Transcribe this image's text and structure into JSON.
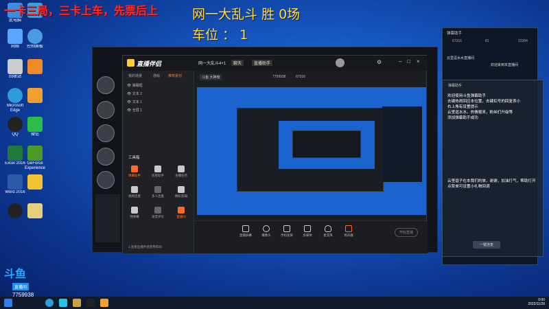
{
  "overlay": {
    "red_banner": "一卡三局，三卡上车，先票后上",
    "stats_line": "网一大乱斗 胜 0场",
    "seat_line": "车位 ： 1"
  },
  "desktop_icons": [
    {
      "label": "此电脑",
      "color": "#3d8de0"
    },
    {
      "label": "",
      "color": "#2ea4e8"
    },
    {
      "label": "网络",
      "color": "#5aa5ff"
    },
    {
      "label": "控制面板",
      "color": "#4a9be0"
    },
    {
      "label": "回收站",
      "color": "#cccccc"
    },
    {
      "label": "",
      "color": "#f08a24"
    },
    {
      "label": "Microsoft Edge",
      "color": "#2e9bdb"
    },
    {
      "label": "",
      "color": "#f0a030"
    },
    {
      "label": "QQ",
      "color": "#222222"
    },
    {
      "label": "微信",
      "color": "#2bbd4a"
    },
    {
      "label": "Excel 2016",
      "color": "#1e7a3e"
    },
    {
      "label": "GeForce Experience",
      "color": "#4b9b26"
    },
    {
      "label": "Word 2016",
      "color": "#2a5aa8"
    },
    {
      "label": "",
      "color": "#f2c230"
    },
    {
      "label": "",
      "color": "#222222"
    },
    {
      "label": "",
      "color": "#e8d07a"
    }
  ],
  "app": {
    "brand": "直播伴侣",
    "left_tabs": [
      "我的场景",
      "游戏",
      "推荐素材"
    ],
    "scenes": [
      "弹幕框",
      "文本 2",
      "文本 1",
      "全屏 1"
    ],
    "toolbox_title": "工具箱",
    "tools": [
      "弹幕助手",
      "房管助手",
      "主播任务",
      "视频连麦",
      "多人连麦",
      "精彩剪辑",
      "弹弹幕",
      "语音评论",
      "直播间"
    ],
    "left_footer": "1.查看直播伴侣使用帮助",
    "title_tabs": [
      "网一大乱斗4+1",
      "聊天",
      "直播助手"
    ],
    "room_info": "斗鱼 大神榜",
    "room_id": "7759938",
    "fans": "67316",
    "bottom_buttons": [
      "直播屏幕",
      "摄像头",
      "手机投屏",
      "多媒体",
      "麦克风",
      "扬声器"
    ],
    "start_button": "开始直播"
  },
  "helper": {
    "title": "弹幕助手",
    "stats": [
      "67316",
      "81",
      "22364"
    ],
    "chat_lines": [
      "云里逗水水直播间",
      "欢迎来到本直播间",
      "欢迎使用斗鱼弹幕助手",
      "去键热闹回应本位置，去键扣号的回复表小",
      "右上角有设置提示",
      "云里逗水水，热情顺来，粉丝们升级等",
      "添加弹幕助手成功",
      "云里逗子在本我们的旅，谢谢，加油打气，帮助打开",
      "点赞单可设置小礼物回调"
    ],
    "sub_title": "弹幕助手",
    "button": "一键连麦"
  },
  "room_badge": {
    "label": "直播间",
    "id": "7759938"
  },
  "taskbar": {
    "time": "0:00",
    "date": "2022/11/28"
  }
}
